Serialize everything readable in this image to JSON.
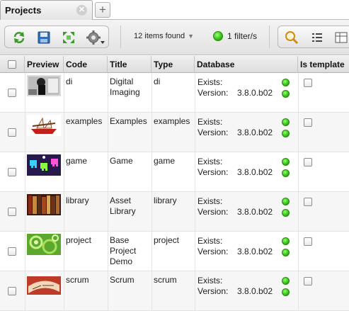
{
  "tab": {
    "label": "Projects",
    "close_icon": "close-icon",
    "add_icon": "plus-icon"
  },
  "toolbar": {
    "items_found": "12 items found",
    "filters": "1 filter/s",
    "icons": [
      "refresh-icon",
      "save-icon",
      "expand-icon",
      "gear-icon",
      "search-icon",
      "list-view-icon",
      "table-view-icon"
    ]
  },
  "table": {
    "headers": {
      "preview": "Preview",
      "code": "Code",
      "title": "Title",
      "type": "Type",
      "database": "Database",
      "is_template": "Is template"
    },
    "exists_label": "Exists:",
    "version_label": "Version:",
    "rows": [
      {
        "code": "di",
        "title": [
          "Digital",
          "Imaging"
        ],
        "type": "di",
        "version": "3.8.0.b02",
        "preview": "film-still-thumbnail"
      },
      {
        "code": "examples",
        "title": [
          "Examples"
        ],
        "type": "examples",
        "version": "3.8.0.b02",
        "preview": "ship-thumbnail"
      },
      {
        "code": "game",
        "title": [
          "Game"
        ],
        "type": "game",
        "version": "3.8.0.b02",
        "preview": "space-invaders-thumbnail"
      },
      {
        "code": "library",
        "title": [
          "Asset",
          "Library"
        ],
        "type": "library",
        "version": "3.8.0.b02",
        "preview": "bookshelf-thumbnail"
      },
      {
        "code": "project",
        "title": [
          "Base",
          "Project",
          "Demo"
        ],
        "type": "project",
        "version": "3.8.0.b02",
        "preview": "gears-thumbnail"
      },
      {
        "code": "scrum",
        "title": [
          "Scrum"
        ],
        "type": "scrum",
        "version": "3.8.0.b02",
        "preview": "scroll-thumbnail"
      }
    ]
  },
  "colors": {
    "status_green": "#2dbd0d",
    "header_bg": "#dcdcdc",
    "toolbar_bg": "#e2e2e2"
  }
}
